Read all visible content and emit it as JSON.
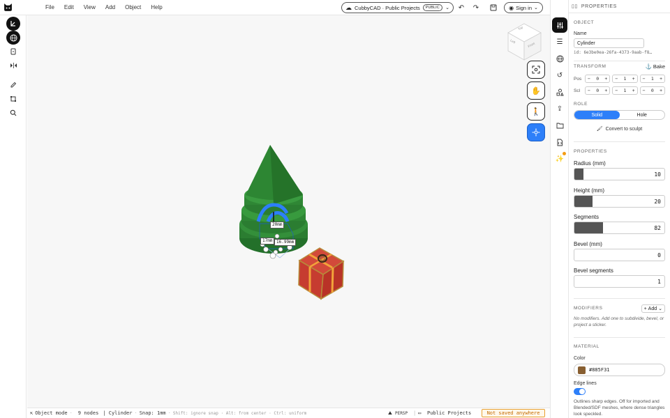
{
  "menu": [
    "File",
    "Edit",
    "View",
    "Add",
    "Object",
    "Help"
  ],
  "project": {
    "title": "CubbyCAD · Public Projects",
    "visibility": "PUBLIC"
  },
  "account": {
    "signin_label": "Sign in"
  },
  "viewcube": {
    "top": "Top",
    "left": "Left",
    "front": "Front"
  },
  "dimensions": {
    "width": "20mm",
    "height": "17mm",
    "diagonal": "16.99mm"
  },
  "status": {
    "mode": "Object mode",
    "nodes": "9 nodes",
    "selection": "| Cylinder",
    "snap": "Snap: 1mm",
    "hint": "Shift: ignore snap · Alt: from center · Ctrl: uniform",
    "camera": "PERSP",
    "project": "Public Projects",
    "save_state": "Not saved anywhere"
  },
  "panel": {
    "header": "PROPERTIES",
    "object": {
      "title": "OBJECT",
      "name_label": "Name",
      "name_value": "Cylinder",
      "id": "id: 6e3be0ea-26fa-4373-9aab-f8…"
    },
    "transform": {
      "title": "TRANSFORM",
      "bake_label": "Bake",
      "pos_label": "Pos",
      "scl_label": "Scl",
      "pos": [
        "0",
        "1",
        "1"
      ],
      "scl": [
        "0",
        "1",
        "0"
      ]
    },
    "role": {
      "title": "ROLE",
      "solid": "Solid",
      "hole": "Hole",
      "convert": "Convert to sculpt"
    },
    "properties": {
      "title": "PROPERTIES",
      "items": [
        {
          "label": "Radius (mm)",
          "value": "10",
          "fill": 0.1
        },
        {
          "label": "Height (mm)",
          "value": "20",
          "fill": 0.2
        },
        {
          "label": "Segments",
          "value": "82",
          "fill": 0.32
        },
        {
          "label": "Bevel (mm)",
          "value": "0",
          "fill": 0
        },
        {
          "label": "Bevel segments",
          "value": "1",
          "fill": 0
        }
      ]
    },
    "modifiers": {
      "title": "MODIFIERS",
      "add_label": "Add",
      "empty": "No modifiers. Add one to subdivide, bevel, or project a sticker."
    },
    "material": {
      "title": "MATERIAL",
      "color_label": "Color",
      "color_value": "#885F31",
      "edge_label": "Edge lines",
      "edge_desc": "Outlines sharp edges. Off for imported and Blended/SDF meshes, where dense triangles look speckled."
    }
  },
  "colors": {
    "accent": "#2d7ff9",
    "tree": "#2e7d32",
    "gift": "#c62828",
    "ribbon": "#f2a33a",
    "material": "#885F31"
  }
}
